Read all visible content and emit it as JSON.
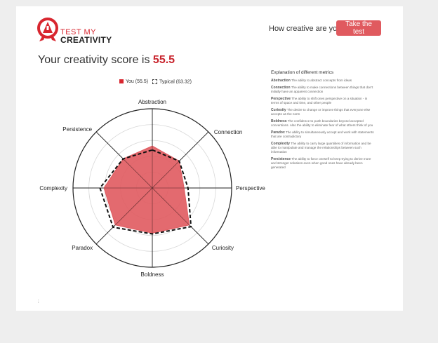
{
  "logo": {
    "top": "TEST MY",
    "bottom": "CREATIVITY"
  },
  "header": {
    "question": "How creative are you?",
    "cta": "Take the test"
  },
  "heading": {
    "prefix": "Your creativity score is ",
    "score": "55.5"
  },
  "legend": {
    "you": "You (55.5)",
    "typical": "Typical (63.32)"
  },
  "colors": {
    "accent": "#d8262f",
    "button": "#e05a5f",
    "fill": "#e05a5f"
  },
  "chart_data": {
    "type": "radar",
    "axes": [
      "Abstraction",
      "Connection",
      "Perspective",
      "Curiosity",
      "Boldness",
      "Paradox",
      "Complexity",
      "Persistence"
    ],
    "rmax": 100,
    "series": [
      {
        "name": "You (55.5)",
        "values": [
          53,
          48,
          40,
          66,
          57,
          66,
          61,
          52
        ]
      },
      {
        "name": "Typical (63.32)",
        "values": [
          48,
          48,
          45,
          69,
          58,
          70,
          66,
          52
        ]
      }
    ]
  },
  "metrics": {
    "title": "Explanation of different metrics",
    "items": [
      {
        "name": "Abstraction",
        "desc": "The ability to abstract concepts from ideas"
      },
      {
        "name": "Connection",
        "desc": "The ability to make connections between things that don't initially have an apparent connection"
      },
      {
        "name": "Perspective",
        "desc": "The ability to shift ones perspective on a situation - in terms of space and time, and other people"
      },
      {
        "name": "Curiosity",
        "desc": "The desire to change or improve things that everyone else accepts as the norm"
      },
      {
        "name": "Boldness",
        "desc": "The confidence to push boundaries beyond accepted conventions. Also the ability to eliminate fear of what others think of you"
      },
      {
        "name": "Paradox",
        "desc": "The ability to simultaneously accept and work with statements that are contradictory"
      },
      {
        "name": "Complexity",
        "desc": "The ability to carry large quantities of information and be able to manipulate and manage the relationships between such information"
      },
      {
        "name": "Persistence",
        "desc": "The ability to force oneself to keep trying to derive more and stronger solutions even when good ones have already been generated"
      }
    ]
  },
  "footer": {
    "mark": ";"
  }
}
